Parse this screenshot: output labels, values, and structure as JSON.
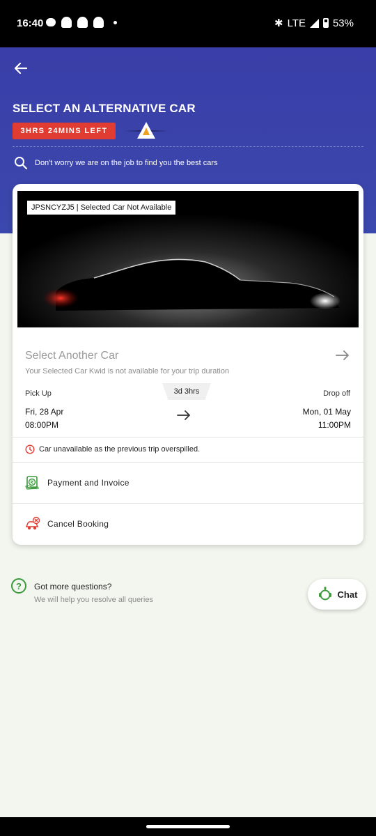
{
  "status_bar": {
    "time": "16:40",
    "network": "LTE",
    "battery": "53%"
  },
  "header": {
    "title": "SELECT AN ALTERNATIVE CAR",
    "timer": "3HRS 24MINS LEFT",
    "info_text": "Don't worry we are on the job to find you the best cars"
  },
  "card": {
    "plate_label": "JPSNCYZJ5 | Selected Car Not Available",
    "select_title": "Select Another Car",
    "select_subtitle": "Your Selected Car Kwid is not available for your trip duration",
    "duration": "3d 3hrs",
    "pickup": {
      "label": "Pick Up",
      "date": "Fri, 28 Apr",
      "time": "08:00PM"
    },
    "dropoff": {
      "label": "Drop off",
      "date": "Mon, 01 May",
      "time": "11:00PM"
    },
    "unavailable_note": "Car unavailable as the previous trip overspilled.",
    "menu": [
      {
        "label": "Payment and Invoice",
        "icon": "payment-icon"
      },
      {
        "label": "Cancel Booking",
        "icon": "cancel-booking-icon"
      }
    ]
  },
  "faq": {
    "title": "Got more questions?",
    "subtitle": "We will help you resolve all queries"
  },
  "chat": {
    "label": "Chat"
  },
  "colors": {
    "header": "#3a3ea8",
    "timer": "#e03c31",
    "accent_green": "#3a9a3a"
  }
}
